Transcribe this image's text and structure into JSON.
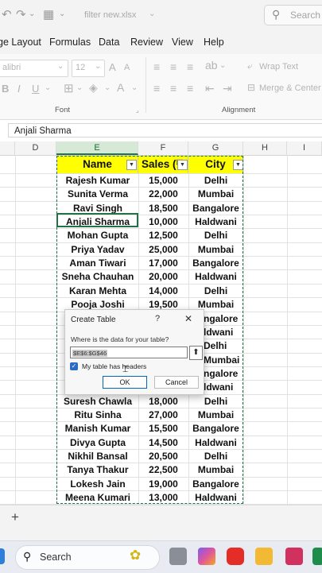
{
  "title_bar": {
    "filename": "filter new.xlsx",
    "search_label": "Search"
  },
  "menu": [
    "ge Layout",
    "Formulas",
    "Data",
    "Review",
    "View",
    "Help"
  ],
  "ribbon": {
    "font_name": "alibri",
    "font_size": "12",
    "font_group_label": "Font",
    "wrap_text_label": "Wrap Text",
    "merge_center_label": "Merge & Center",
    "alignment_group_label": "Alignment"
  },
  "formula_bar": {
    "value": "Anjali Sharma"
  },
  "columns": [
    "D",
    "E",
    "F",
    "G",
    "H",
    "I"
  ],
  "table": {
    "headers": [
      "Name",
      "Sales (₹",
      "City"
    ],
    "rows": [
      [
        "Rajesh Kumar",
        "15,000",
        "Delhi"
      ],
      [
        "Sunita Verma",
        "22,000",
        "Mumbai"
      ],
      [
        "Ravi Singh",
        "18,500",
        "Bangalore"
      ],
      [
        "Anjali Sharma",
        "10,000",
        "Haldwani"
      ],
      [
        "Mohan Gupta",
        "12,500",
        "Delhi"
      ],
      [
        "Priya Yadav",
        "25,000",
        "Mumbai"
      ],
      [
        "Aman Tiwari",
        "17,000",
        "Bangalore"
      ],
      [
        "Sneha Chauhan",
        "20,000",
        "Haldwani"
      ],
      [
        "Karan Mehta",
        "14,000",
        "Delhi"
      ],
      [
        "Pooja Joshi",
        "19,500",
        "Mumbai"
      ],
      [
        "",
        "",
        "ngalore"
      ],
      [
        "",
        "",
        "ldwani"
      ],
      [
        "",
        "",
        "Delhi"
      ],
      [
        "",
        "",
        "Mumbai"
      ],
      [
        "",
        "",
        "ngalore"
      ],
      [
        "",
        "",
        "ldwani"
      ],
      [
        "Suresh Chawla",
        "18,000",
        "Delhi"
      ],
      [
        "Ritu Sinha",
        "27,000",
        "Mumbai"
      ],
      [
        "Manish Kumar",
        "15,500",
        "Bangalore"
      ],
      [
        "Divya Gupta",
        "14,500",
        "Haldwani"
      ],
      [
        "Nikhil Bansal",
        "20,500",
        "Delhi"
      ],
      [
        "Tanya Thakur",
        "22,500",
        "Mumbai"
      ],
      [
        "Lokesh Jain",
        "19,000",
        "Bangalore"
      ],
      [
        "Meena Kumari",
        "13,000",
        "Haldwani"
      ]
    ]
  },
  "dialog": {
    "title": "Create Table",
    "help": "?",
    "close": "✕",
    "prompt": "Where is the data for your table?",
    "range_value": "$E$6:$G$46",
    "checkbox_label": "My table has headers",
    "checkbox_checked": true,
    "ok_label": "OK",
    "cancel_label": "Cancel"
  },
  "sheet_bar": {
    "add_label": "+"
  },
  "taskbar": {
    "search_label": "Search"
  },
  "colors": {
    "accent": "#217346",
    "header_fill": "#ffff00",
    "dialog_primary": "#0067c0"
  }
}
